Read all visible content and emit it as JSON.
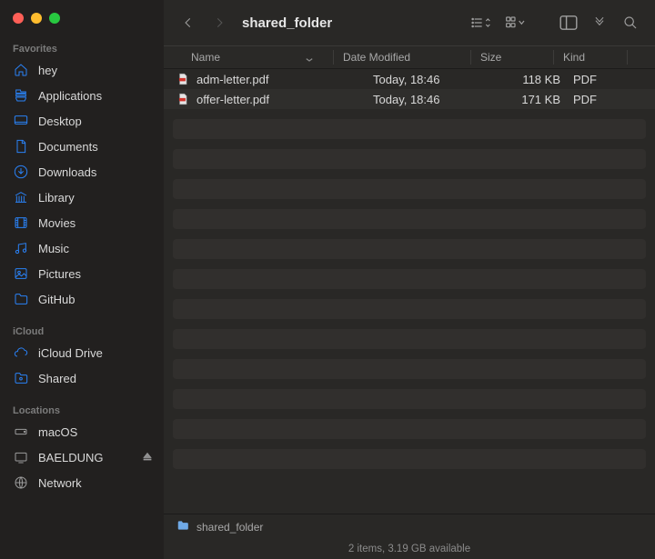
{
  "window": {
    "title": "shared_folder"
  },
  "sidebar": {
    "sections": {
      "favorites": {
        "label": "Favorites"
      },
      "icloud": {
        "label": "iCloud"
      },
      "locations": {
        "label": "Locations"
      }
    },
    "favorites": [
      {
        "label": "hey"
      },
      {
        "label": "Applications"
      },
      {
        "label": "Desktop"
      },
      {
        "label": "Documents"
      },
      {
        "label": "Downloads"
      },
      {
        "label": "Library"
      },
      {
        "label": "Movies"
      },
      {
        "label": "Music"
      },
      {
        "label": "Pictures"
      },
      {
        "label": "GitHub"
      }
    ],
    "icloud": [
      {
        "label": "iCloud Drive"
      },
      {
        "label": "Shared"
      }
    ],
    "locations": [
      {
        "label": "macOS"
      },
      {
        "label": "BAELDUNG"
      },
      {
        "label": "Network"
      }
    ]
  },
  "columns": {
    "name": "Name",
    "date_modified": "Date Modified",
    "size": "Size",
    "kind": "Kind"
  },
  "files": [
    {
      "name": "adm-letter.pdf",
      "date": "Today, 18:46",
      "size": "118 KB",
      "kind": "PDF"
    },
    {
      "name": "offer-letter.pdf",
      "date": "Today, 18:46",
      "size": "171 KB",
      "kind": "PDF"
    }
  ],
  "pathbar": {
    "folder": "shared_folder"
  },
  "status": {
    "text": "2 items, 3.19 GB available"
  }
}
